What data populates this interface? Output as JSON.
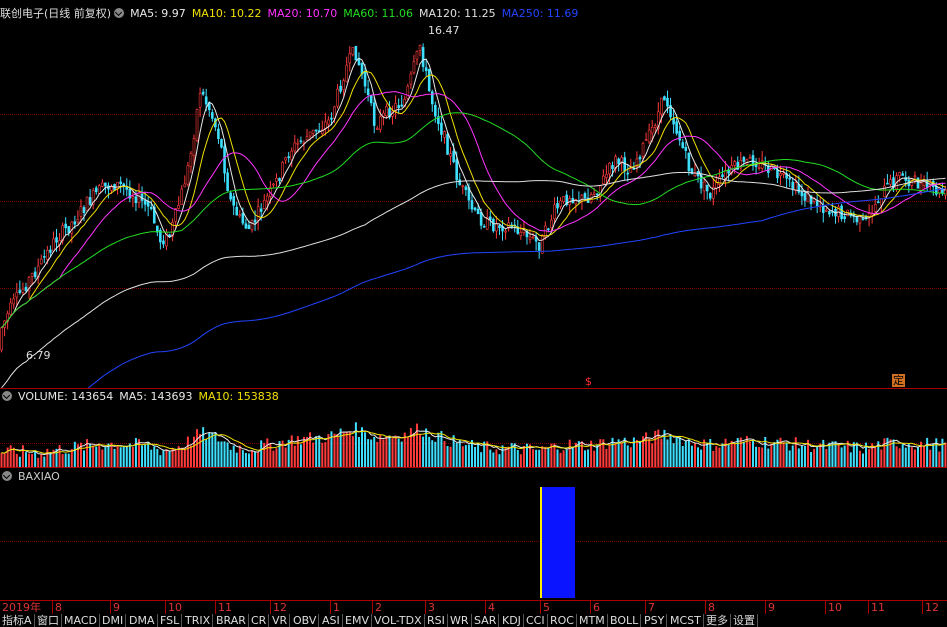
{
  "main_header": {
    "title": "联创电子(日线 前复权)",
    "ma": [
      {
        "label": "MA5: 9.97",
        "color": "#e8e8e8"
      },
      {
        "label": "MA10: 10.22",
        "color": "#f0e000"
      },
      {
        "label": "MA20: 10.70",
        "color": "#ff33ff"
      },
      {
        "label": "MA60: 11.06",
        "color": "#22dd22"
      },
      {
        "label": "MA120: 11.25",
        "color": "#e0e0e0"
      },
      {
        "label": "MA250: 11.69",
        "color": "#2244ff"
      }
    ]
  },
  "price_labels": {
    "high": "16.47",
    "low": "6.79"
  },
  "markers": {
    "s": "$",
    "ding": "定"
  },
  "volume_header": [
    {
      "label": "VOLUME: 143654",
      "color": "#e8e8e8"
    },
    {
      "label": "MA5: 143693",
      "color": "#e8e8e8"
    },
    {
      "label": "MA10: 153838",
      "color": "#f0e000"
    }
  ],
  "indicator_header": {
    "label": "BAXIAO",
    "color": "#cccccc"
  },
  "time_axis": [
    "2019年",
    "8",
    "9",
    "10",
    "11",
    "12",
    "1",
    "2",
    "3",
    "4",
    "5",
    "6",
    "7",
    "8",
    "9",
    "10",
    "11",
    "12"
  ],
  "tabs": [
    "指标A",
    "窗口",
    "MACD",
    "DMI",
    "DMA",
    "FSL",
    "TRIX",
    "BRAR",
    "CR",
    "VR",
    "OBV",
    "ASI",
    "EMV",
    "VOL-TDX",
    "RSI",
    "WR",
    "SAR",
    "KDJ",
    "CCI",
    "ROC",
    "MTM",
    "BOLL",
    "PSY",
    "MCST",
    "更多",
    "设置"
  ],
  "colors": {
    "up": "#ff3b3b",
    "down": "#3ee0ff",
    "grid": "#7a0000",
    "axis": "#aa0000",
    "baxiao_bar": "#0a14ff",
    "baxiao_edge": "#ffee00"
  }
}
